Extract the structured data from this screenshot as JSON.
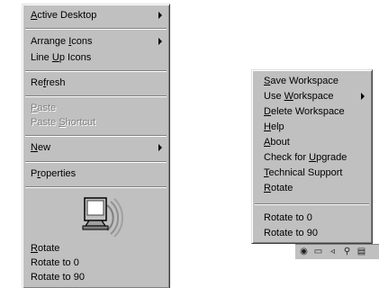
{
  "context_menu": {
    "items": [
      {
        "prefix": "",
        "mnemonic": "A",
        "suffix": "ctive Desktop",
        "submenu": true,
        "disabled": false
      },
      {
        "prefix": "Arrange ",
        "mnemonic": "I",
        "suffix": "cons",
        "submenu": true,
        "disabled": false
      },
      {
        "prefix": "Line ",
        "mnemonic": "U",
        "suffix": "p Icons",
        "submenu": false,
        "disabled": false
      },
      {
        "prefix": "Re",
        "mnemonic": "f",
        "suffix": "resh",
        "submenu": false,
        "disabled": false
      },
      {
        "prefix": "",
        "mnemonic": "P",
        "suffix": "aste",
        "submenu": false,
        "disabled": true
      },
      {
        "prefix": "Paste ",
        "mnemonic": "S",
        "suffix": "hortcut",
        "submenu": false,
        "disabled": true
      },
      {
        "prefix": "",
        "mnemonic": "N",
        "suffix": "ew",
        "submenu": true,
        "disabled": false
      },
      {
        "prefix": "P",
        "mnemonic": "r",
        "suffix": "operties",
        "submenu": false,
        "disabled": false
      },
      {
        "prefix": "",
        "mnemonic": "R",
        "suffix": "otate",
        "submenu": false,
        "disabled": false
      },
      {
        "prefix": "Rotate to 0",
        "mnemonic": "",
        "suffix": "",
        "submenu": false,
        "disabled": false
      },
      {
        "prefix": "Rotate to 90",
        "mnemonic": "",
        "suffix": "",
        "submenu": false,
        "disabled": false
      }
    ],
    "icon": "display-settings-icon"
  },
  "tray_menu": {
    "items": [
      {
        "prefix": "",
        "mnemonic": "S",
        "suffix": "ave Workspace",
        "submenu": false
      },
      {
        "prefix": "Use ",
        "mnemonic": "W",
        "suffix": "orkspace",
        "submenu": true
      },
      {
        "prefix": "",
        "mnemonic": "D",
        "suffix": "elete Workspace",
        "submenu": false
      },
      {
        "prefix": "",
        "mnemonic": "H",
        "suffix": "elp",
        "submenu": false
      },
      {
        "prefix": "",
        "mnemonic": "A",
        "suffix": "bout",
        "submenu": false
      },
      {
        "prefix": "Check for ",
        "mnemonic": "U",
        "suffix": "pgrade",
        "submenu": false
      },
      {
        "prefix": "",
        "mnemonic": "T",
        "suffix": "echnical Support",
        "submenu": false
      },
      {
        "prefix": "",
        "mnemonic": "R",
        "suffix": "otate",
        "submenu": false
      },
      {
        "prefix": "Rotate to 0",
        "mnemonic": "",
        "suffix": "",
        "submenu": false
      },
      {
        "prefix": "Rotate to 90",
        "mnemonic": "",
        "suffix": "",
        "submenu": false
      }
    ]
  },
  "taskbar": {
    "tray_icons": [
      "tray-icon-1",
      "tray-icon-2",
      "tray-icon-3",
      "tray-icon-4",
      "tray-icon-5"
    ]
  },
  "colors": {
    "menu_face": "#c0c0c0",
    "disabled_text": "#808080"
  }
}
